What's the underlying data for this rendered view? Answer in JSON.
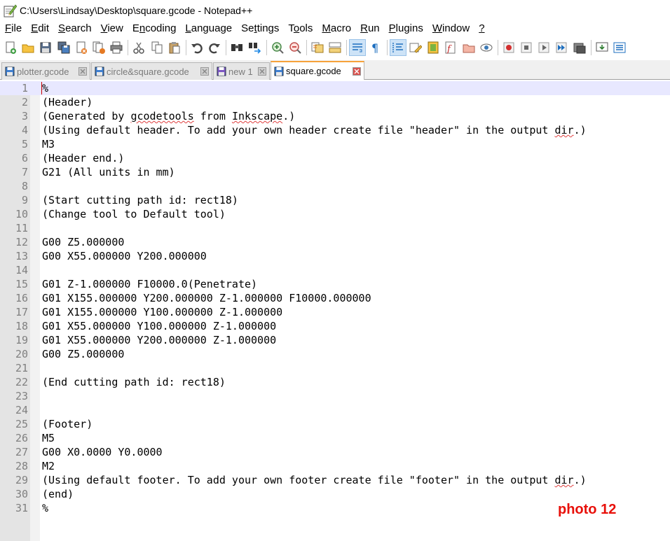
{
  "window": {
    "title": "C:\\Users\\Lindsay\\Desktop\\square.gcode - Notepad++"
  },
  "menu": [
    {
      "acc": "F",
      "rest": "ile"
    },
    {
      "acc": "E",
      "rest": "dit"
    },
    {
      "acc": "S",
      "rest": "earch"
    },
    {
      "acc": "V",
      "rest": "iew"
    },
    {
      "pre": "E",
      "acc": "n",
      "rest": "coding"
    },
    {
      "acc": "L",
      "rest": "anguage"
    },
    {
      "pre": "Se",
      "acc": "t",
      "rest": "tings"
    },
    {
      "pre": "T",
      "acc": "o",
      "rest": "ols"
    },
    {
      "acc": "M",
      "rest": "acro"
    },
    {
      "acc": "R",
      "rest": "un"
    },
    {
      "acc": "P",
      "rest": "lugins"
    },
    {
      "acc": "W",
      "rest": "indow"
    },
    {
      "acc": "?",
      "rest": ""
    }
  ],
  "toolbar_icons": [
    "new-file-icon",
    "open-file-icon",
    "save-icon",
    "save-all-icon",
    "close-icon",
    "close-all-icon",
    "print-icon",
    "|",
    "cut-icon",
    "copy-icon",
    "paste-icon",
    "|",
    "undo-icon",
    "redo-icon",
    "|",
    "find-icon",
    "replace-icon",
    "|",
    "zoom-in-icon",
    "zoom-out-icon",
    "|",
    "sync-vertical-icon",
    "sync-horizontal-icon",
    "|",
    "word-wrap-icon",
    "show-all-chars-icon",
    "|",
    "indent-guide-icon",
    "udl-icon",
    "document-map-icon",
    "function-list-icon",
    "folder-workspace-icon",
    "monitoring-icon",
    "|",
    "record-macro-icon",
    "stop-macro-icon",
    "play-macro-icon",
    "run-macro-multiple-icon",
    "save-macro-icon",
    "|",
    "launch-icon",
    "spell-check-icon"
  ],
  "tabs": [
    {
      "label": "plotter.gcode",
      "active": false,
      "modified": false
    },
    {
      "label": "circle&square.gcode",
      "active": false,
      "modified": false
    },
    {
      "label": "new 1",
      "active": false,
      "modified": false
    },
    {
      "label": "square.gcode",
      "active": true,
      "modified": false
    }
  ],
  "editor": {
    "current_line": 1,
    "lines": [
      {
        "n": "1",
        "text": "%"
      },
      {
        "n": "2",
        "text": "(Header)"
      },
      {
        "n": "3",
        "text": "(Generated by gcodetools from Inkscape.)"
      },
      {
        "n": "4",
        "text": "(Using default header. To add your own header create file \"header\" in the output dir.)"
      },
      {
        "n": "5",
        "text": "M3"
      },
      {
        "n": "6",
        "text": "(Header end.)"
      },
      {
        "n": "7",
        "text": "G21 (All units in mm)"
      },
      {
        "n": "8",
        "text": ""
      },
      {
        "n": "9",
        "text": "(Start cutting path id: rect18)"
      },
      {
        "n": "10",
        "text": "(Change tool to Default tool)"
      },
      {
        "n": "11",
        "text": ""
      },
      {
        "n": "12",
        "text": "G00 Z5.000000"
      },
      {
        "n": "13",
        "text": "G00 X55.000000 Y200.000000"
      },
      {
        "n": "14",
        "text": ""
      },
      {
        "n": "15",
        "text": "G01 Z-1.000000 F10000.0(Penetrate)"
      },
      {
        "n": "16",
        "text": "G01 X155.000000 Y200.000000 Z-1.000000 F10000.000000"
      },
      {
        "n": "17",
        "text": "G01 X155.000000 Y100.000000 Z-1.000000"
      },
      {
        "n": "18",
        "text": "G01 X55.000000 Y100.000000 Z-1.000000"
      },
      {
        "n": "19",
        "text": "G01 X55.000000 Y200.000000 Z-1.000000"
      },
      {
        "n": "20",
        "text": "G00 Z5.000000"
      },
      {
        "n": "21",
        "text": ""
      },
      {
        "n": "22",
        "text": "(End cutting path id: rect18)"
      },
      {
        "n": "23",
        "text": ""
      },
      {
        "n": "24",
        "text": ""
      },
      {
        "n": "25",
        "text": "(Footer)"
      },
      {
        "n": "26",
        "text": "M5"
      },
      {
        "n": "27",
        "text": "G00 X0.0000 Y0.0000"
      },
      {
        "n": "28",
        "text": "M2"
      },
      {
        "n": "29",
        "text": "(Using default footer. To add your own footer create file \"footer\" in the output dir.)"
      },
      {
        "n": "30",
        "text": "(end)"
      },
      {
        "n": "31",
        "text": "%"
      }
    ]
  },
  "annotation": {
    "label": "photo 12",
    "color": "#e8100a"
  },
  "colors": {
    "gutter": "#e4e4e4",
    "current_line": "#e8e8ff",
    "active_tab_accent": "#f7a23b"
  }
}
